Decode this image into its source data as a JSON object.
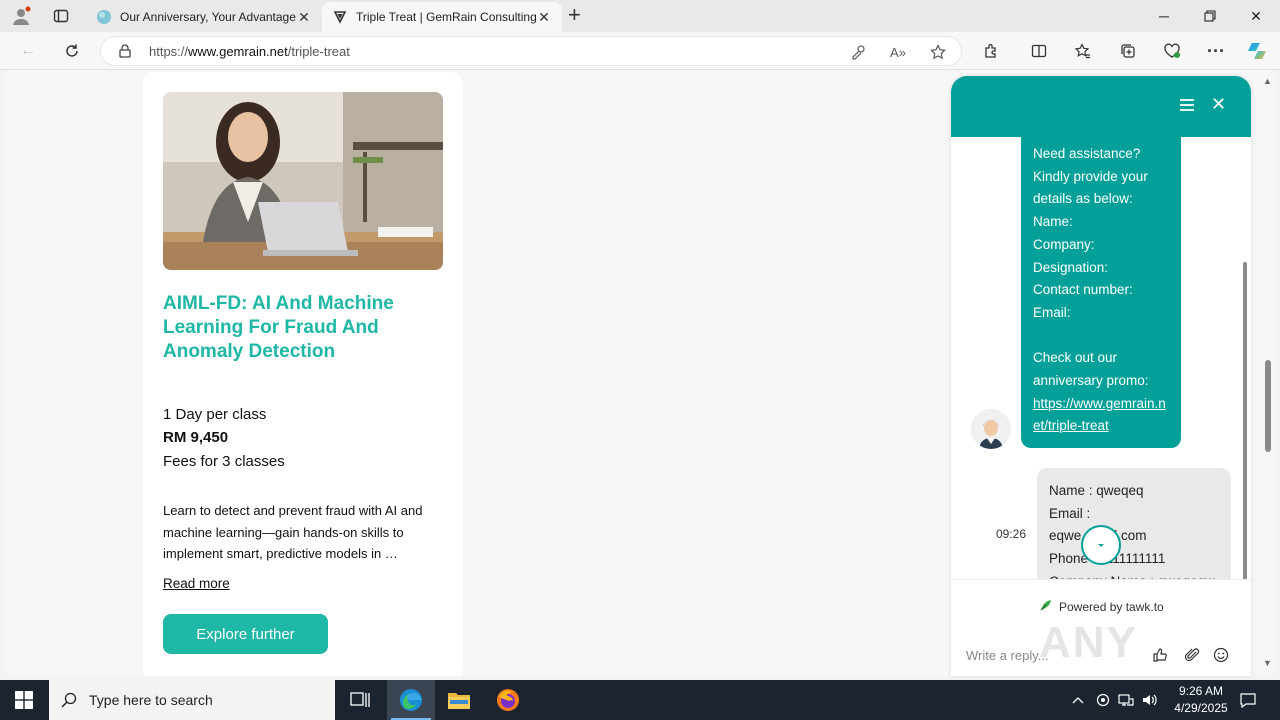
{
  "browser": {
    "tabs": [
      {
        "title": "Our Anniversary, Your Advantage",
        "active": false
      },
      {
        "title": "Triple Treat | GemRain Consulting",
        "active": true
      }
    ],
    "url_prefix": "https://",
    "url_domain": "www.gemrain.net",
    "url_path": "/triple-treat"
  },
  "course": {
    "title": "AIML-FD: AI And Machine Learning For Fraud And Anomaly Detection",
    "duration": "1 Day per class",
    "price": "RM 9,450",
    "fees_note": "Fees for 3 classes",
    "description": "Learn to detect and prevent fraud with AI and machine learning—gain hands-on skills to implement smart, predictive models in …",
    "read_more": "Read more",
    "cta": "Explore further"
  },
  "chat": {
    "agent_message": {
      "lines": [
        "Need assistance?",
        "Kindly provide your",
        "details as below:",
        "Name:",
        "Company:",
        "Designation:",
        "Contact number:",
        "Email:",
        "",
        "Check out our",
        "anniversary promo:"
      ],
      "link_lines": [
        "https://www.gemrain.n",
        "et/triple-treat"
      ]
    },
    "user_message": {
      "time": "09:26",
      "lines": [
        "Name : qweqeq",
        "Email :",
        "eqwe gmail.com",
        "Phone : 1111111111",
        "Company Name : qweqeqw"
      ]
    },
    "powered_by": "Powered by tawk.to",
    "reply_placeholder": "Write a reply..."
  },
  "taskbar": {
    "search_placeholder": "Type here to search",
    "time": "9:26 AM",
    "date": "4/29/2025"
  },
  "watermark": "ANY RUN",
  "colors": {
    "accent": "#1fb7a6",
    "chat_header": "#03a09a",
    "taskbar": "#1c2430"
  }
}
